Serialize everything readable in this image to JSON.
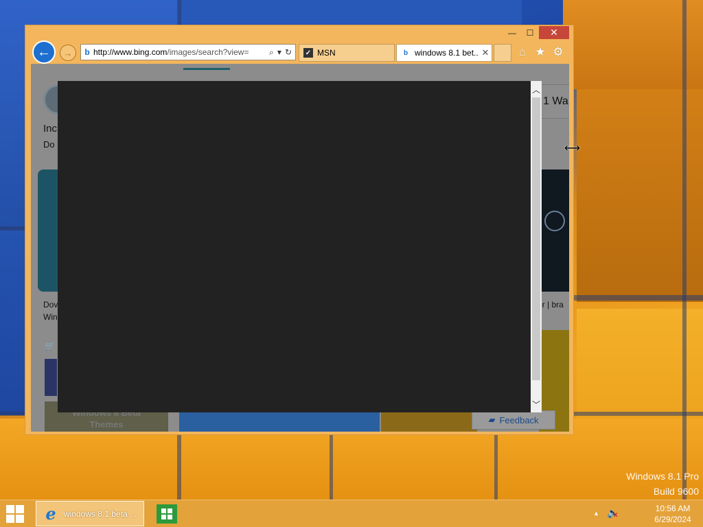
{
  "browser": {
    "address": {
      "url_host": "http://www.bing.com",
      "url_rest": "/images/search?view=",
      "bing_glyph": "b"
    },
    "tabs": [
      {
        "label": "MSN",
        "icon": "msn-icon"
      },
      {
        "label": "windows 8.1 bet...",
        "icon": "bing-icon",
        "active": true
      }
    ],
    "title_buttons": {
      "minimize": "—",
      "maximize": "☐",
      "close": "✕"
    },
    "right_icons": [
      "home-icon",
      "favorites-star-icon",
      "settings-gear-icon"
    ]
  },
  "page": {
    "right_partial_text": "1 Wa",
    "left_partial_1": "Inc",
    "left_partial_2": "Do",
    "caption_left_1": "Dov",
    "caption_left_2": "Win",
    "caption_right": "er | bra",
    "themes_label": "Windows 8 Beta Themes",
    "feedback": "Feedback"
  },
  "watermark": {
    "line1": "Windows 8.1 Pro",
    "line2": "Build 9600"
  },
  "taskbar": {
    "ie_task_label": "windows 8.1 beta ...",
    "time": "10:56 AM",
    "date": "6/29/2024"
  },
  "colors": {
    "overlay": "#222222",
    "taskbar": "#e4a23a",
    "window_frame": "#f3b65c",
    "close_button": "#c7463a",
    "ie_blue": "#1e6fcf"
  }
}
